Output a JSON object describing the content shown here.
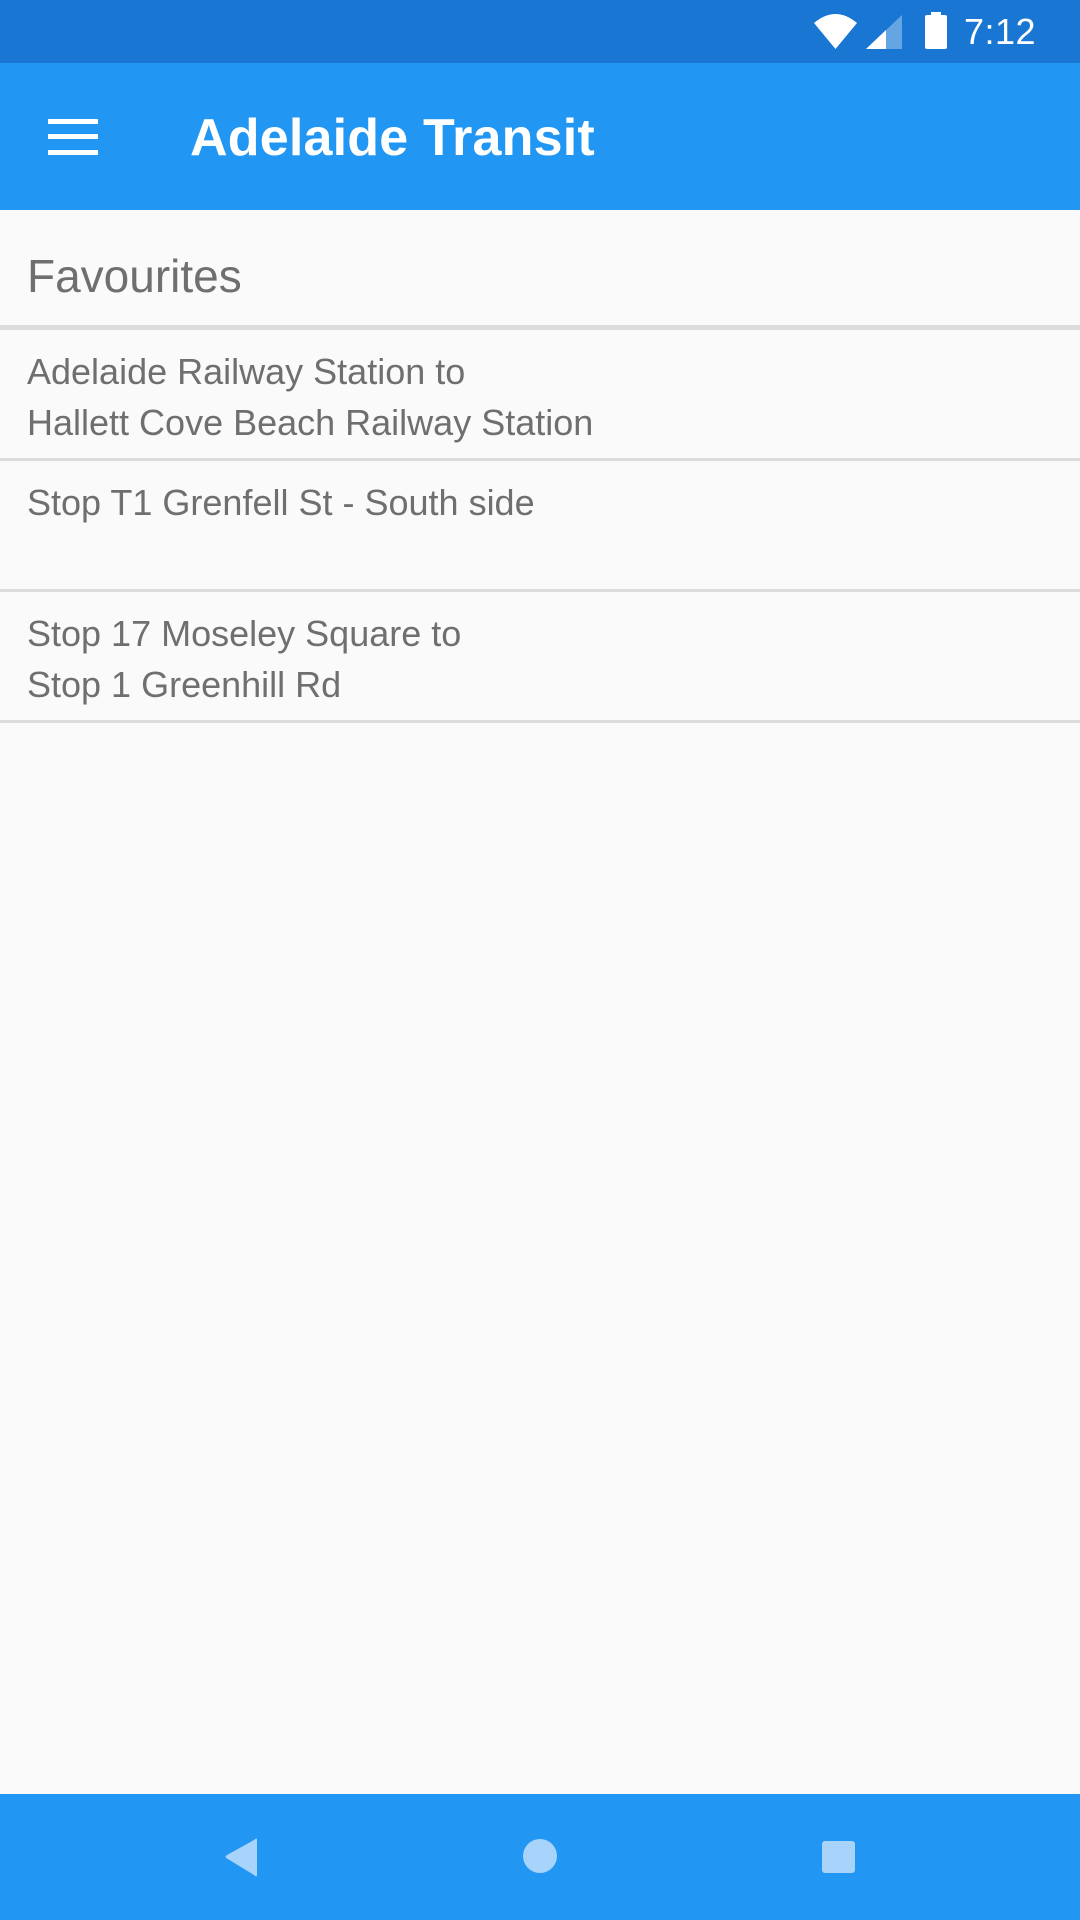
{
  "status_bar": {
    "time": "7:12",
    "icons": [
      "wifi-icon",
      "cell-signal-icon",
      "battery-icon"
    ]
  },
  "app_bar": {
    "menu_icon": "hamburger-menu-icon",
    "title": "Adelaide Transit"
  },
  "favourites": {
    "header": "Favourites",
    "items": [
      {
        "line1": "Adelaide Railway Station to",
        "line2": "Hallett Cove Beach Railway Station"
      },
      {
        "line1": "Stop T1 Grenfell St - South side",
        "line2": ""
      },
      {
        "line1": "Stop 17 Moseley Square to",
        "line2": "Stop 1 Greenhill Rd"
      }
    ]
  },
  "nav_bar": {
    "buttons": [
      "back-icon",
      "home-icon",
      "recents-icon"
    ]
  },
  "colors": {
    "status_bar": "#1976d2",
    "app_bar": "#2196f3",
    "background": "#fafafa",
    "text": "#6f6f6f",
    "divider": "#dcdcdc",
    "nav_icon": "#a8d3fb"
  }
}
